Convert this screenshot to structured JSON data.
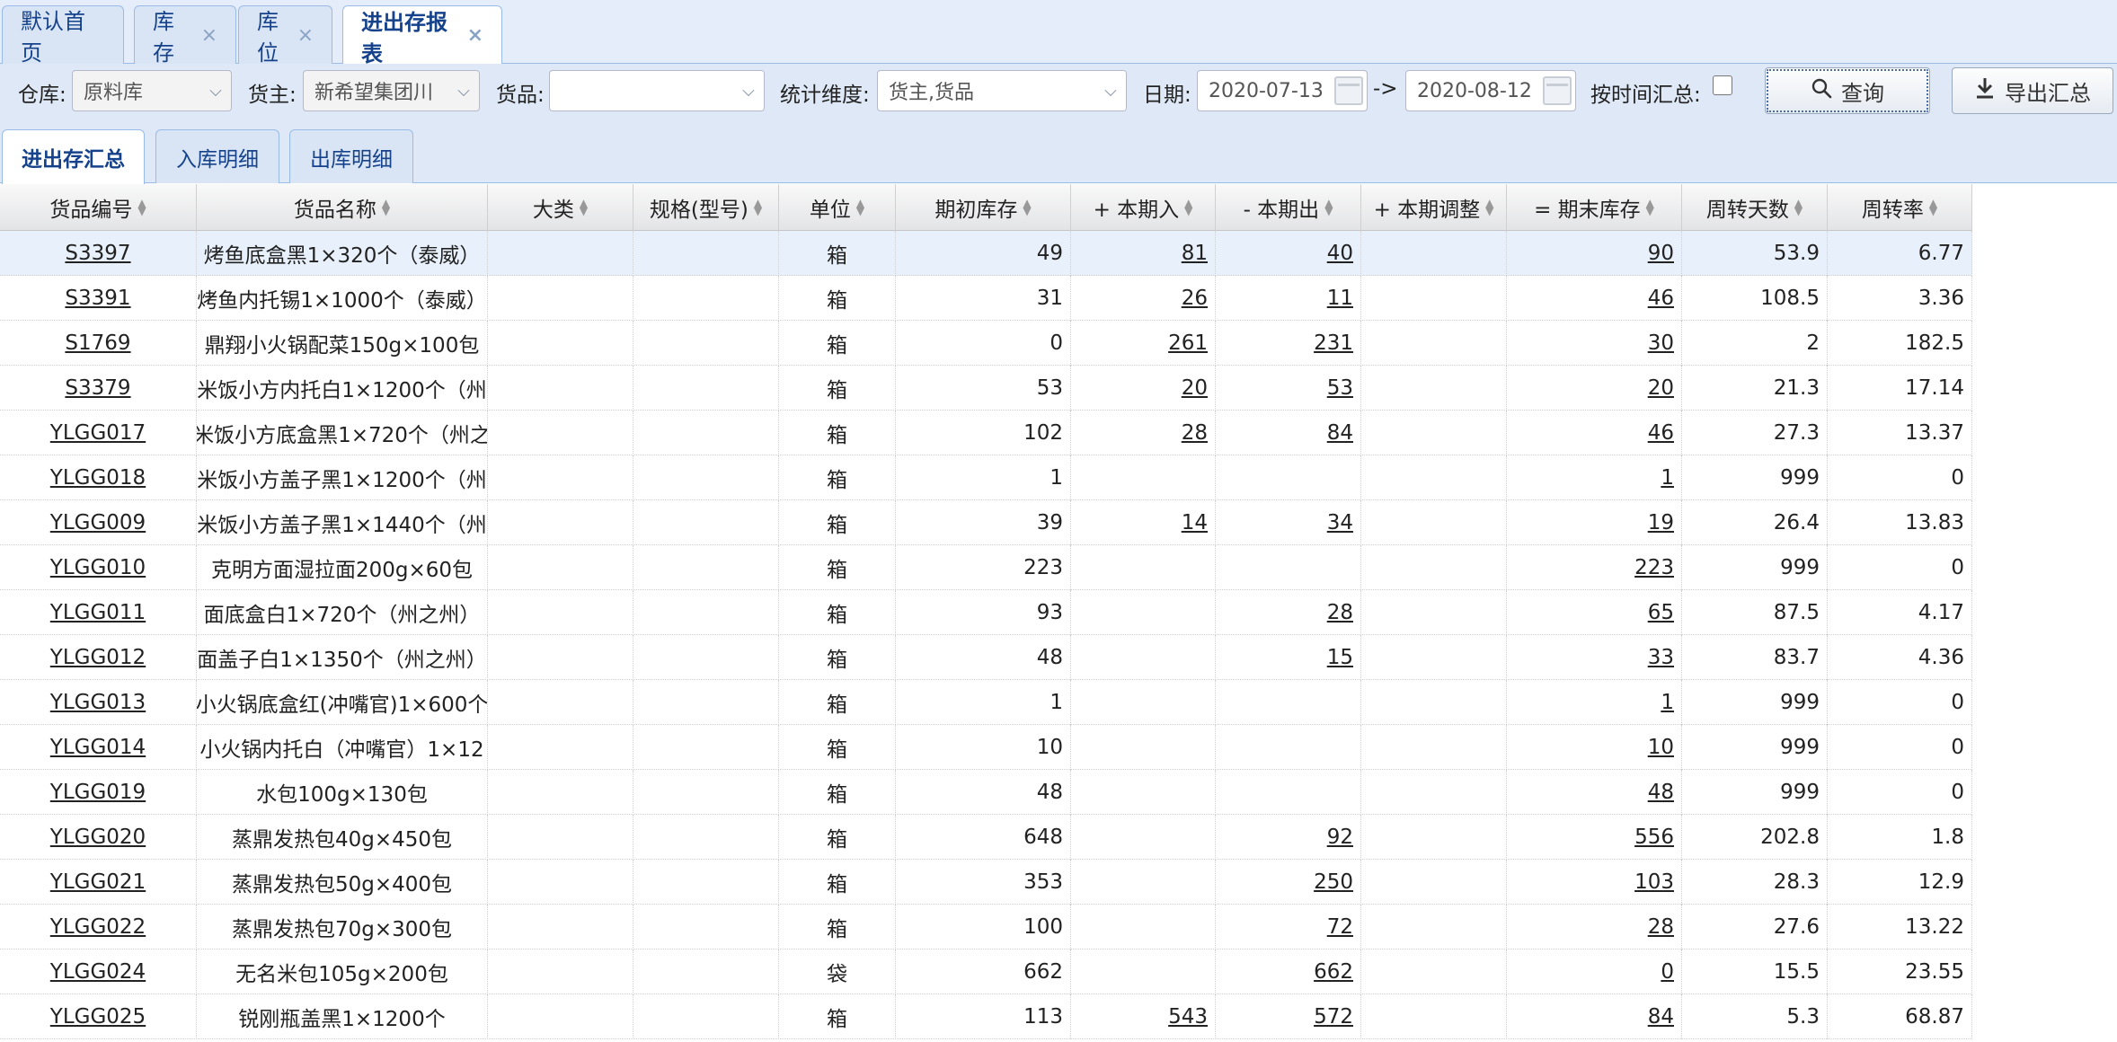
{
  "top_tabs": [
    {
      "label": "默认首页",
      "closable": false,
      "active": false
    },
    {
      "label": "库存",
      "closable": true,
      "active": false
    },
    {
      "label": "库位",
      "closable": true,
      "active": false
    },
    {
      "label": "进出存报表",
      "closable": true,
      "active": true
    }
  ],
  "close_glyph": "×",
  "filters": {
    "warehouse_label": "仓库:",
    "warehouse_value": "原料库",
    "owner_label": "货主:",
    "owner_value": "新希望集团川",
    "goods_label": "货品:",
    "goods_value": "",
    "dimension_label": "统计维度:",
    "dimension_value": "货主,货品",
    "date_label": "日期:",
    "date_from": "2020-07-13",
    "date_sep": "->",
    "date_to": "2020-08-12",
    "group_by_time_label": "按时间汇总:",
    "group_by_time_checked": false,
    "query_button": "查询",
    "export_button": "导出汇总"
  },
  "sub_tabs": [
    {
      "label": "进出存汇总",
      "active": true
    },
    {
      "label": "入库明细",
      "active": false
    },
    {
      "label": "出库明细",
      "active": false
    }
  ],
  "columns": [
    "货品编号",
    "货品名称",
    "大类",
    "规格(型号)",
    "单位",
    "期初库存",
    "+ 本期入",
    "- 本期出",
    "+ 本期调整",
    "= 期末库存",
    "周转天数",
    "周转率"
  ],
  "rows": [
    {
      "code": "S3397",
      "name": "烤鱼底盒黑1×320个（泰威）",
      "category": "",
      "spec": "",
      "unit": "箱",
      "opening": "49",
      "in": "81",
      "out": "40",
      "adjust": "",
      "closing": "90",
      "days": "53.9",
      "rate": "6.77"
    },
    {
      "code": "S3391",
      "name": "烤鱼内托锡1×1000个（泰威）",
      "category": "",
      "spec": "",
      "unit": "箱",
      "opening": "31",
      "in": "26",
      "out": "11",
      "adjust": "",
      "closing": "46",
      "days": "108.5",
      "rate": "3.36"
    },
    {
      "code": "S1769",
      "name": "鼎翔小火锅配菜150g×100包",
      "category": "",
      "spec": "",
      "unit": "箱",
      "opening": "0",
      "in": "261",
      "out": "231",
      "adjust": "",
      "closing": "30",
      "days": "2",
      "rate": "182.5"
    },
    {
      "code": "S3379",
      "name": "米饭小方内托白1×1200个（州",
      "category": "",
      "spec": "",
      "unit": "箱",
      "opening": "53",
      "in": "20",
      "out": "53",
      "adjust": "",
      "closing": "20",
      "days": "21.3",
      "rate": "17.14"
    },
    {
      "code": "YLGG017",
      "name": "米饭小方底盒黑1×720个（州之",
      "category": "",
      "spec": "",
      "unit": "箱",
      "opening": "102",
      "in": "28",
      "out": "84",
      "adjust": "",
      "closing": "46",
      "days": "27.3",
      "rate": "13.37"
    },
    {
      "code": "YLGG018",
      "name": "米饭小方盖子黑1×1200个（州",
      "category": "",
      "spec": "",
      "unit": "箱",
      "opening": "1",
      "in": "",
      "out": "",
      "adjust": "",
      "closing": "1",
      "days": "999",
      "rate": "0"
    },
    {
      "code": "YLGG009",
      "name": "米饭小方盖子黑1×1440个（州",
      "category": "",
      "spec": "",
      "unit": "箱",
      "opening": "39",
      "in": "14",
      "out": "34",
      "adjust": "",
      "closing": "19",
      "days": "26.4",
      "rate": "13.83"
    },
    {
      "code": "YLGG010",
      "name": "克明方面湿拉面200g×60包",
      "category": "",
      "spec": "",
      "unit": "箱",
      "opening": "223",
      "in": "",
      "out": "",
      "adjust": "",
      "closing": "223",
      "days": "999",
      "rate": "0"
    },
    {
      "code": "YLGG011",
      "name": "面底盒白1×720个（州之州）",
      "category": "",
      "spec": "",
      "unit": "箱",
      "opening": "93",
      "in": "",
      "out": "28",
      "adjust": "",
      "closing": "65",
      "days": "87.5",
      "rate": "4.17"
    },
    {
      "code": "YLGG012",
      "name": "面盖子白1×1350个（州之州）",
      "category": "",
      "spec": "",
      "unit": "箱",
      "opening": "48",
      "in": "",
      "out": "15",
      "adjust": "",
      "closing": "33",
      "days": "83.7",
      "rate": "4.36"
    },
    {
      "code": "YLGG013",
      "name": "小火锅底盒红(冲嘴官)1×600个",
      "category": "",
      "spec": "",
      "unit": "箱",
      "opening": "1",
      "in": "",
      "out": "",
      "adjust": "",
      "closing": "1",
      "days": "999",
      "rate": "0"
    },
    {
      "code": "YLGG014",
      "name": "小火锅内托白（冲嘴官）1×12",
      "category": "",
      "spec": "",
      "unit": "箱",
      "opening": "10",
      "in": "",
      "out": "",
      "adjust": "",
      "closing": "10",
      "days": "999",
      "rate": "0"
    },
    {
      "code": "YLGG019",
      "name": "水包100g×130包",
      "category": "",
      "spec": "",
      "unit": "箱",
      "opening": "48",
      "in": "",
      "out": "",
      "adjust": "",
      "closing": "48",
      "days": "999",
      "rate": "0"
    },
    {
      "code": "YLGG020",
      "name": "蒸鼎发热包40g×450包",
      "category": "",
      "spec": "",
      "unit": "箱",
      "opening": "648",
      "in": "",
      "out": "92",
      "adjust": "",
      "closing": "556",
      "days": "202.8",
      "rate": "1.8"
    },
    {
      "code": "YLGG021",
      "name": "蒸鼎发热包50g×400包",
      "category": "",
      "spec": "",
      "unit": "箱",
      "opening": "353",
      "in": "",
      "out": "250",
      "adjust": "",
      "closing": "103",
      "days": "28.3",
      "rate": "12.9"
    },
    {
      "code": "YLGG022",
      "name": "蒸鼎发热包70g×300包",
      "category": "",
      "spec": "",
      "unit": "箱",
      "opening": "100",
      "in": "",
      "out": "72",
      "adjust": "",
      "closing": "28",
      "days": "27.6",
      "rate": "13.22"
    },
    {
      "code": "YLGG024",
      "name": "无名米包105g×200包",
      "category": "",
      "spec": "",
      "unit": "袋",
      "opening": "662",
      "in": "",
      "out": "662",
      "adjust": "",
      "closing": "0",
      "days": "15.5",
      "rate": "23.55"
    },
    {
      "code": "YLGG025",
      "name": "锐刚瓶盖黑1×1200个",
      "category": "",
      "spec": "",
      "unit": "箱",
      "opening": "113",
      "in": "543",
      "out": "572",
      "adjust": "",
      "closing": "84",
      "days": "5.3",
      "rate": "68.87"
    }
  ],
  "colors": {
    "accent": "#15428b",
    "tab_border": "#99bbe8",
    "toolbar_bg": "#dfe8f6",
    "selected_row": "#e8f0fb"
  }
}
